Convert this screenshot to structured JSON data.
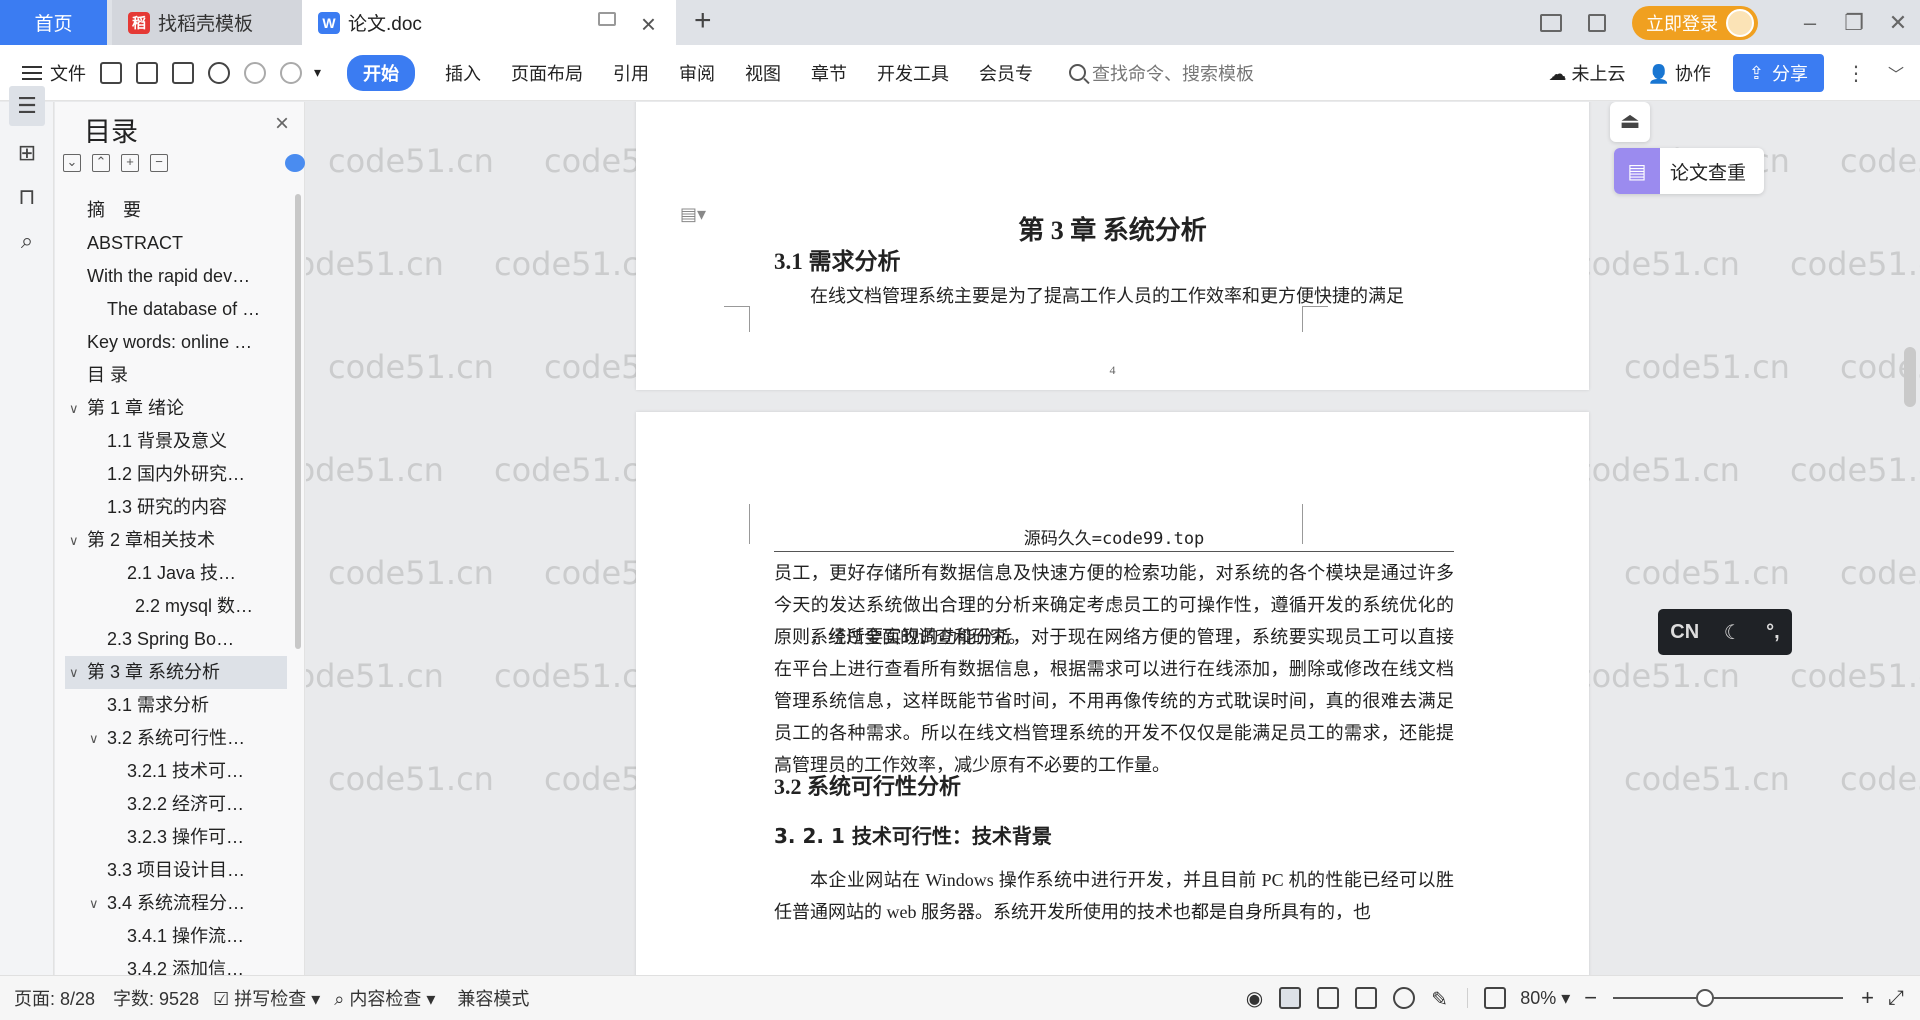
{
  "tabs": {
    "home": "首页",
    "zhaodaoke": "找稻壳模板",
    "doc": "论文.doc"
  },
  "account": {
    "login_label": "立即登录"
  },
  "toolbar": {
    "file": "文件",
    "menus": [
      "开始",
      "插入",
      "页面布局",
      "引用",
      "审阅",
      "视图",
      "章节",
      "开发工具",
      "会员专"
    ],
    "search_placeholder": "查找命令、搜索模板",
    "cloud": "未上云",
    "collab": "协作",
    "share": "分享"
  },
  "toc": {
    "title": "目录",
    "items": [
      {
        "label": "摘　要",
        "level": 1
      },
      {
        "label": "ABSTRACT",
        "level": 1
      },
      {
        "label": "With the rapid dev…",
        "level": 1
      },
      {
        "label": "The database of …",
        "level": 2
      },
      {
        "label": "Key words: online …",
        "level": 1
      },
      {
        "label": "目 录",
        "level": 1
      },
      {
        "label": "第 1 章  绪论",
        "level": 1,
        "caret": true
      },
      {
        "label": "1.1 背景及意义",
        "level": 2
      },
      {
        "label": "1.2  国内外研究…",
        "level": 2
      },
      {
        "label": "1.3  研究的内容",
        "level": 2
      },
      {
        "label": "第 2 章相关技术",
        "level": 1,
        "caret": true
      },
      {
        "label": "2.1    Java 技…",
        "level": 3
      },
      {
        "label": "2.2 mysql 数…",
        "level": 4
      },
      {
        "label": "2.3 Spring    Bo…",
        "level": 2
      },
      {
        "label": "第 3 章  系统分析",
        "level": 1,
        "caret": true,
        "selected": true
      },
      {
        "label": "3.1  需求分析",
        "level": 2
      },
      {
        "label": "3.2  系统可行性…",
        "level": 2,
        "caret": true
      },
      {
        "label": "3.2.1 技术可…",
        "level": 3
      },
      {
        "label": "3.2.2 经济可…",
        "level": 3
      },
      {
        "label": "3.2.3 操作可…",
        "level": 3
      },
      {
        "label": "3.3  项目设计目…",
        "level": 2
      },
      {
        "label": "3.4 系统流程分…",
        "level": 2,
        "caret": true
      },
      {
        "label": "3.4.1 操作流…",
        "level": 3
      },
      {
        "label": "3.4.2 添加信…",
        "level": 3
      }
    ]
  },
  "document": {
    "chapter": "第 3 章  系统分析",
    "sec31": "3.1  需求分析",
    "p1": "在线文档管理系统主要是为了提高工作人员的工作效率和更方便快捷的满足",
    "page_number": "4",
    "header": "源码久久=code99.top",
    "p2": "员工，更好存储所有数据信息及快速方便的检索功能，对系统的各个模块是通过许多今天的发达系统做出合理的分析来确定考虑员工的可操作性，遵循开发的系统优化的原则，经过全面的调查和研究。",
    "p3": "系统所要实现的功能分析，对于现在网络方便的管理，系统要实现员工可以直接在平台上进行查看所有数据信息，根据需求可以进行在线添加，删除或修改在线文档管理系统信息，这样既能节省时间，不用再像传统的方式耽误时间，真的很难去满足员工的各种需求。所以在线文档管理系统的开发不仅仅是能满足员工的需求，还能提高管理员的工作效率，减少原有不必要的工作量。",
    "sec32": "3.2  系统可行性分析",
    "sec321": "3. 2. 1 技术可行性：技术背景",
    "p4": "本企业网站在 Windows 操作系统中进行开发，并且目前 PC 机的性能已经可以胜任普通网站的 web 服务器。系统开发所使用的技术也都是自身所具有的，也"
  },
  "watermark": "code51.cn",
  "float": {
    "check_label": "论文查重",
    "ime_lang": "CN"
  },
  "status": {
    "page": "页面: 8/28",
    "words": "字数: 9528",
    "spell": "拼写检查",
    "content_check": "内容检查",
    "compat": "兼容模式",
    "zoom": "80%",
    "zoom_level": 0.4
  },
  "colors": {
    "accent": "#3b7cf2",
    "login": "#f0a020",
    "selected": "#dde1e7"
  }
}
